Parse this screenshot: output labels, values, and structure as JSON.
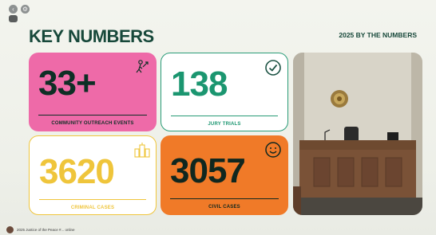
{
  "window": {
    "pill_label": "Prs"
  },
  "header": {
    "title": "KEY NUMBERS",
    "subtitle": "2025 BY THE NUMBERS"
  },
  "cards": [
    {
      "value": "33+",
      "label": "COMMUNITY OUTREACH EVENTS",
      "icon": "person-growth-icon",
      "bg": "#ee6aa8",
      "fg": "#0e2f25"
    },
    {
      "value": "138",
      "label": "JURY TRIALS",
      "icon": "check-circle-icon",
      "bg": "#ffffff",
      "fg": "#1b9670"
    },
    {
      "value": "3620",
      "label": "CRIMINAL CASES",
      "icon": "city-icon",
      "bg": "#ffffff",
      "fg": "#efc53b"
    },
    {
      "value": "3057",
      "label": "CIVIL CASES",
      "icon": "smile-icon",
      "bg": "#f07a28",
      "fg": "#10271f"
    }
  ],
  "photo": {
    "icon": "courtroom-photo"
  },
  "footer": {
    "text": "2025 Justice of the Peace #... online"
  }
}
